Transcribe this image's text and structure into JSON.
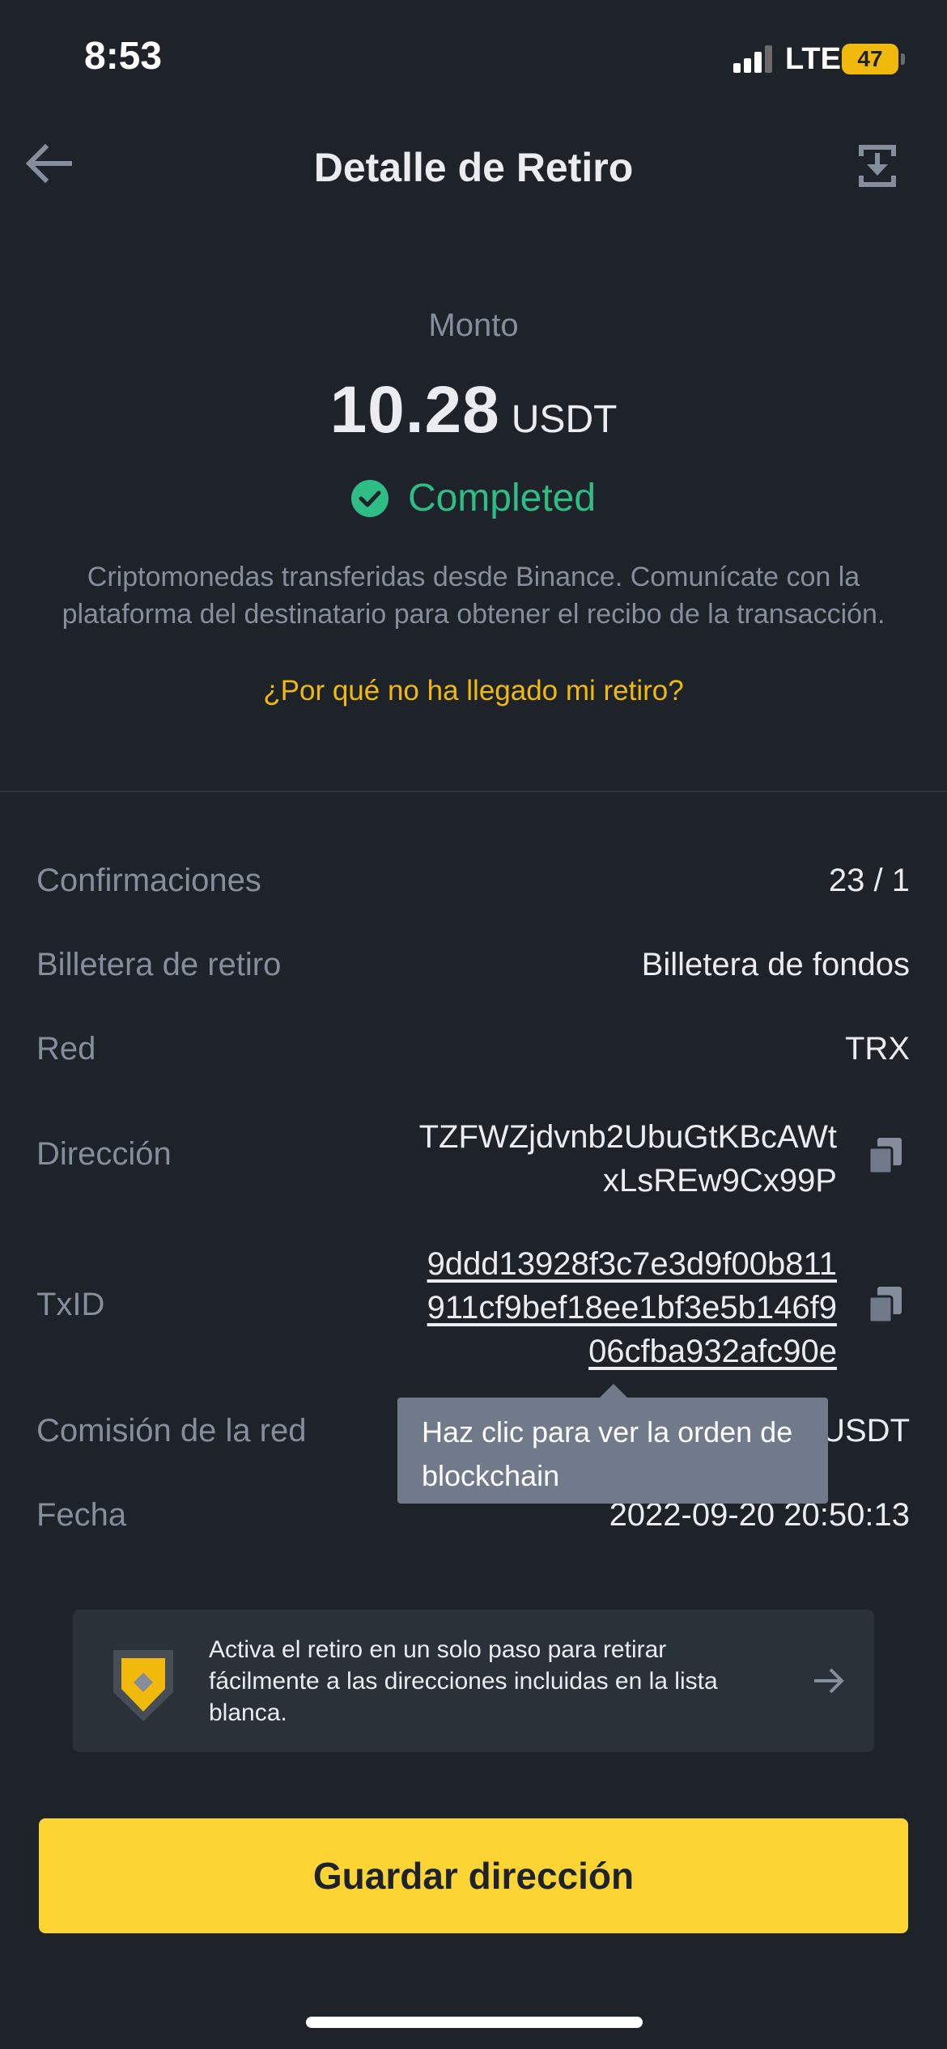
{
  "status_bar": {
    "time": "8:53",
    "network": "LTE",
    "battery": "47"
  },
  "header": {
    "title": "Detalle de Retiro"
  },
  "amount": {
    "label": "Monto",
    "value": "10.28",
    "unit": "USDT",
    "status": "Completed",
    "description": "Criptomonedas transferidas desde Binance. Comunícate con la plataforma del destinatario para obtener el recibo de la transacción.",
    "why_link": "¿Por qué no ha llegado mi retiro?"
  },
  "details": {
    "confirmations": {
      "label": "Confirmaciones",
      "value": "23 / 1"
    },
    "wallet": {
      "label": "Billetera de retiro",
      "value": "Billetera de fondos"
    },
    "network": {
      "label": "Red",
      "value": "TRX"
    },
    "address": {
      "label": "Dirección",
      "line1": "TZFWZjdvnb2UbuGtKBcAWt",
      "line2": "xLsREw9Cx99P"
    },
    "txid": {
      "label": "TxID",
      "line1": "9ddd13928f3c7e3d9f00b811",
      "line2": "911cf9bef18ee1bf3e5b146f9",
      "line3": "06cfba932afc90e"
    },
    "fee": {
      "label": "Comisión de la red",
      "value_visible": "USDT"
    },
    "date": {
      "label": "Fecha",
      "value": "2022-09-20 20:50:13"
    }
  },
  "tooltip": {
    "line1": "Haz clic para ver la orden de",
    "line2": "blockchain"
  },
  "banner": {
    "text": "Activa el retiro en un solo paso para retirar fácilmente a las direcciones incluidas en la lista blanca."
  },
  "actions": {
    "save_label": "Guardar dirección"
  },
  "colors": {
    "background": "#1e2329",
    "accent": "#f0b90b",
    "success": "#2ebd85",
    "button": "#fcd535",
    "muted": "#848e9c"
  }
}
